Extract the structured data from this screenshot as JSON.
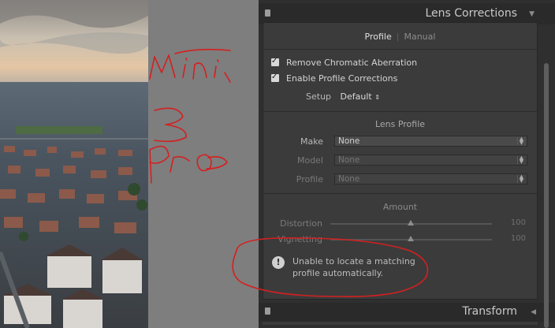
{
  "lens_corrections": {
    "title": "Lens Corrections",
    "tabs": [
      {
        "label": "Profile",
        "active": true
      },
      {
        "label": "Manual",
        "active": false
      }
    ],
    "remove_ca_label": "Remove Chromatic Aberration",
    "remove_ca_checked": true,
    "enable_profile_label": "Enable Profile Corrections",
    "enable_profile_checked": true,
    "setup_label": "Setup",
    "setup_value": "Default",
    "lens_profile_title": "Lens Profile",
    "make_label": "Make",
    "make_value": "None",
    "model_label": "Model",
    "model_value": "None",
    "profile_label": "Profile",
    "profile_value": "None",
    "amount_title": "Amount",
    "distortion_label": "Distortion",
    "distortion_value": "100",
    "vignetting_label": "Vignetting",
    "vignetting_value": "100",
    "warning_line1": "Unable to locate a matching",
    "warning_line2": "profile automatically."
  },
  "transform": {
    "title": "Transform"
  },
  "annotation": {
    "handwritten_text": "Mini 3 Pro",
    "color": "#d42020"
  },
  "colors": {
    "panel_bg": "#3b3b3b",
    "header_bg": "#2a2a2a",
    "accent_red": "#d42020"
  }
}
